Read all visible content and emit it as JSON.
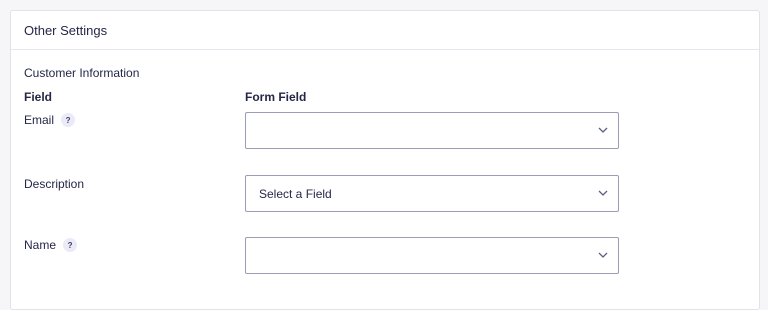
{
  "panel": {
    "title": "Other Settings"
  },
  "section": {
    "title": "Customer Information",
    "col_field": "Field",
    "col_form_field": "Form Field"
  },
  "rows": [
    {
      "label": "Email",
      "help": "?",
      "value": ""
    },
    {
      "label": "Description",
      "value": "Select a Field"
    },
    {
      "label": "Name",
      "help": "?",
      "value": ""
    }
  ],
  "icons": {
    "help": "question-icon",
    "dropdown": "chevron-down-icon"
  },
  "colors": {
    "text": "#242748",
    "border": "#9b9cb5",
    "help_bg": "#ebeaf7"
  }
}
